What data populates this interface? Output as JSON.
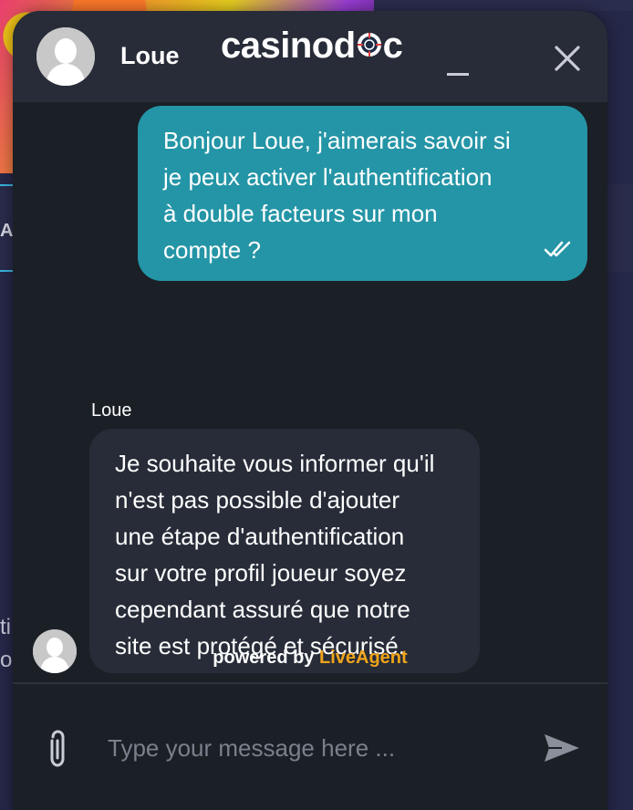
{
  "header": {
    "agent_name": "Loue",
    "brand": {
      "prefix": "casino",
      "suffix": "c",
      "middle": "d"
    },
    "minimize_icon": "minimize-icon",
    "close_icon": "close-icon"
  },
  "messages": [
    {
      "direction": "outgoing",
      "lines": [
        "Bonjour Loue, j'aimerais savoir si",
        "je peux activer l'authentification",
        "à double facteurs sur mon",
        "compte ?"
      ],
      "status_icon": "double-check-icon"
    },
    {
      "direction": "incoming",
      "sender": "Loue",
      "lines": [
        "Je souhaite vous informer qu'il",
        "n'est pas possible d'ajouter",
        "une étape d'authentification",
        "sur votre profil joueur soyez",
        "cependant assuré que notre",
        "site est protégé et sécurisé."
      ]
    }
  ],
  "footer": {
    "powered_by_prefix": "powered by ",
    "powered_by_brand": "LiveAgent"
  },
  "composer": {
    "placeholder": "Type your message here ...",
    "value": "",
    "attach_icon": "paperclip-icon",
    "send_icon": "send-icon"
  },
  "background": {
    "partial_text_a": "A",
    "partial_text_1": "ti",
    "partial_text_2": "oi"
  },
  "colors": {
    "outgoing_bubble": "#2495a6",
    "incoming_bubble": "#272c38",
    "chat_background": "#1b1f26",
    "brand_accent": "#f0a41a"
  }
}
